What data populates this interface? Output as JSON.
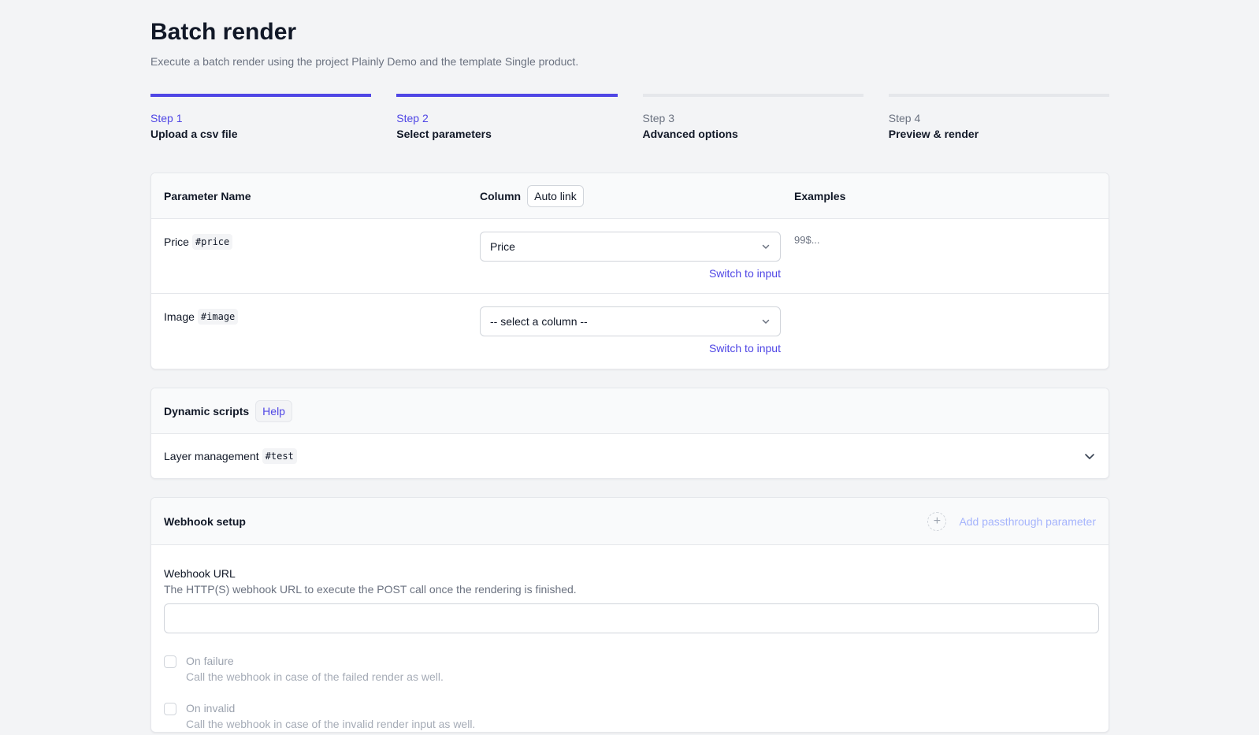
{
  "page": {
    "title": "Batch render",
    "subtitle": "Execute a batch render using the project Plainly Demo and the template Single product."
  },
  "steps": [
    {
      "num": "Step 1",
      "name": "Upload a csv file",
      "active": true
    },
    {
      "num": "Step 2",
      "name": "Select parameters",
      "active": true
    },
    {
      "num": "Step 3",
      "name": "Advanced options",
      "active": false
    },
    {
      "num": "Step 4",
      "name": "Preview & render",
      "active": false
    }
  ],
  "params_table": {
    "header_name": "Parameter Name",
    "header_column": "Column",
    "auto_link": "Auto link",
    "header_examples": "Examples",
    "rows": [
      {
        "name": "Price",
        "key": "#price",
        "selected": "Price",
        "switch": "Switch to input",
        "example": "99$..."
      },
      {
        "name": "Image",
        "key": "#image",
        "selected": "-- select a column --",
        "switch": "Switch to input",
        "example": ""
      }
    ]
  },
  "dynamic_scripts": {
    "title": "Dynamic scripts",
    "help": "Help",
    "item_name": "Layer management",
    "item_key": "#test",
    "icon": "chevron-down-icon"
  },
  "webhook": {
    "title": "Webhook setup",
    "add_passthrough": "Add passthrough parameter",
    "url_label": "Webhook URL",
    "url_desc": "The HTTP(S) webhook URL to execute the POST call once the rendering is finished.",
    "url_value": "",
    "on_failure_label": "On failure",
    "on_failure_desc": "Call the webhook in case of the failed render as well.",
    "on_invalid_label": "On invalid",
    "on_invalid_desc": "Call the webhook in case of the invalid render input as well."
  },
  "colors": {
    "accent": "#4f46e5",
    "inactive_step": "#e5e7eb",
    "background": "#f3f4f6"
  }
}
